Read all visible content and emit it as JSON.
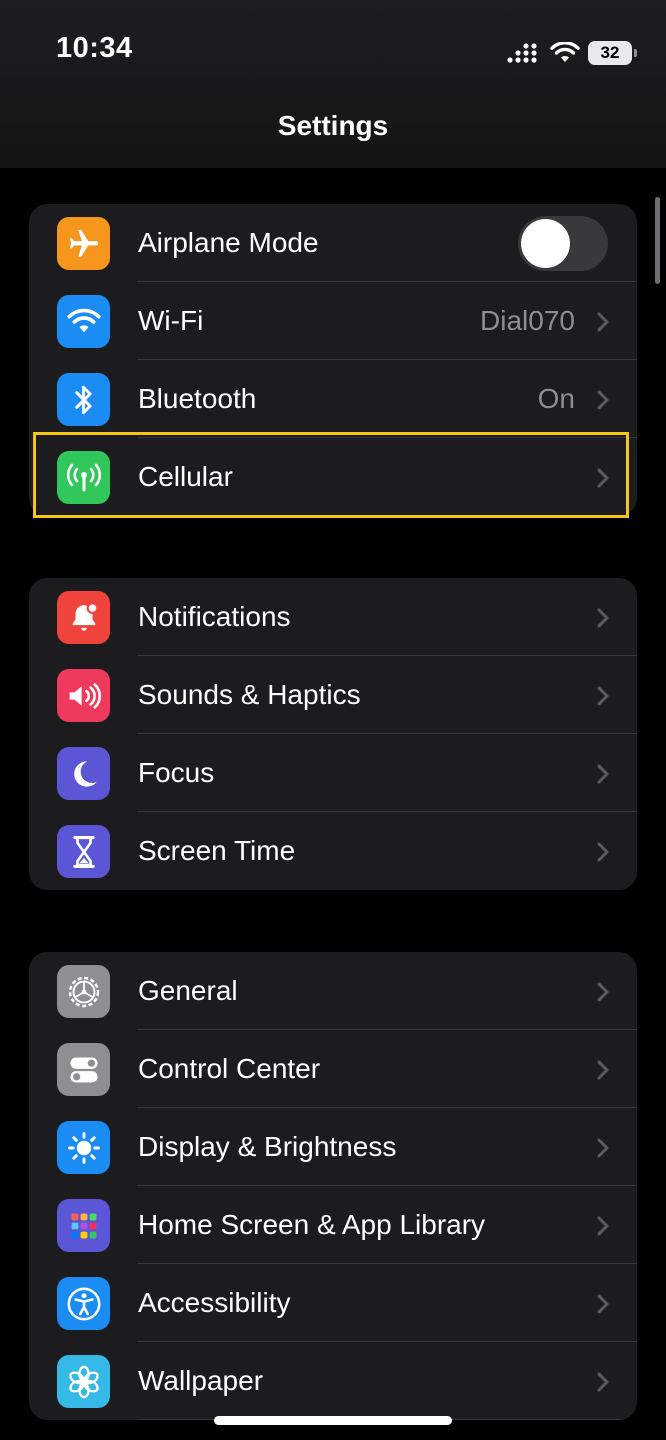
{
  "status_bar": {
    "time": "10:34",
    "battery": "32"
  },
  "nav": {
    "title": "Settings"
  },
  "group1": [
    {
      "id": "airplane",
      "label": "Airplane Mode",
      "value": "",
      "icon": "airplane-icon",
      "color": "#f7961c",
      "control": "toggle",
      "toggle_on": false
    },
    {
      "id": "wifi",
      "label": "Wi-Fi",
      "value": "Dial070",
      "icon": "wifi-icon",
      "color": "#1a8cf4",
      "control": "chevron"
    },
    {
      "id": "bluetooth",
      "label": "Bluetooth",
      "value": "On",
      "icon": "bluetooth-icon",
      "color": "#1a8cf4",
      "control": "chevron"
    },
    {
      "id": "cellular",
      "label": "Cellular",
      "value": "",
      "icon": "antenna-icon",
      "color": "#32c75a",
      "control": "chevron",
      "highlighted": true
    }
  ],
  "group2": [
    {
      "id": "notifications",
      "label": "Notifications",
      "icon": "bell-icon",
      "color": "#f0433b"
    },
    {
      "id": "sounds",
      "label": "Sounds & Haptics",
      "icon": "speaker-icon",
      "color": "#ef3a5d"
    },
    {
      "id": "focus",
      "label": "Focus",
      "icon": "moon-icon",
      "color": "#5a56d6"
    },
    {
      "id": "screen-time",
      "label": "Screen Time",
      "icon": "hourglass-icon",
      "color": "#5a56d6"
    }
  ],
  "group3": [
    {
      "id": "general",
      "label": "General",
      "icon": "gear-icon",
      "color": "#8e8e93"
    },
    {
      "id": "control-center",
      "label": "Control Center",
      "icon": "switches-icon",
      "color": "#8e8e93"
    },
    {
      "id": "display",
      "label": "Display & Brightness",
      "icon": "sun-icon",
      "color": "#1a8cf4"
    },
    {
      "id": "home-screen",
      "label": "Home Screen & App Library",
      "icon": "app-grid-icon",
      "color": "#5a56d6"
    },
    {
      "id": "accessibility",
      "label": "Accessibility",
      "icon": "accessibility-icon",
      "color": "#1a8cf4"
    },
    {
      "id": "wallpaper",
      "label": "Wallpaper",
      "icon": "flower-icon",
      "color": "#35b9e6"
    }
  ],
  "colors": {
    "highlight": "#f5c518",
    "cell_bg": "#1c1c1e",
    "secondary_text": "#8d8d93"
  }
}
